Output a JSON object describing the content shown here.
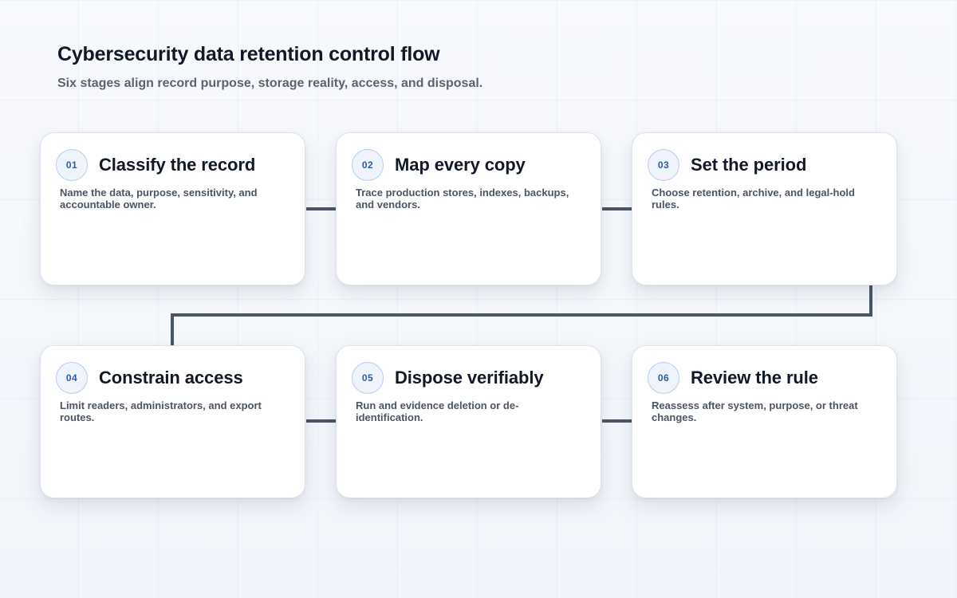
{
  "header": {
    "title": "Cybersecurity data retention control flow",
    "subtitle": "Six stages align record purpose, storage reality, access, and disposal."
  },
  "stages": [
    {
      "number": "01",
      "title": "Classify the record",
      "description": "Name the data, purpose, sensitivity, and accountable owner."
    },
    {
      "number": "02",
      "title": "Map every copy",
      "description": "Trace production stores, indexes, backups, and vendors."
    },
    {
      "number": "03",
      "title": "Set the period",
      "description": "Choose retention, archive, and legal-hold rules."
    },
    {
      "number": "04",
      "title": "Constrain access",
      "description": "Limit readers, administrators, and export routes."
    },
    {
      "number": "05",
      "title": "Dispose verifiably",
      "description": "Run and evidence deletion or de-identification."
    },
    {
      "number": "06",
      "title": "Review the rule",
      "description": "Reassess after system, purpose, or threat changes."
    }
  ],
  "colors": {
    "connector": "#4a5568",
    "badge_text": "#2f5ca8",
    "badge_border": "#b9cdf0"
  }
}
